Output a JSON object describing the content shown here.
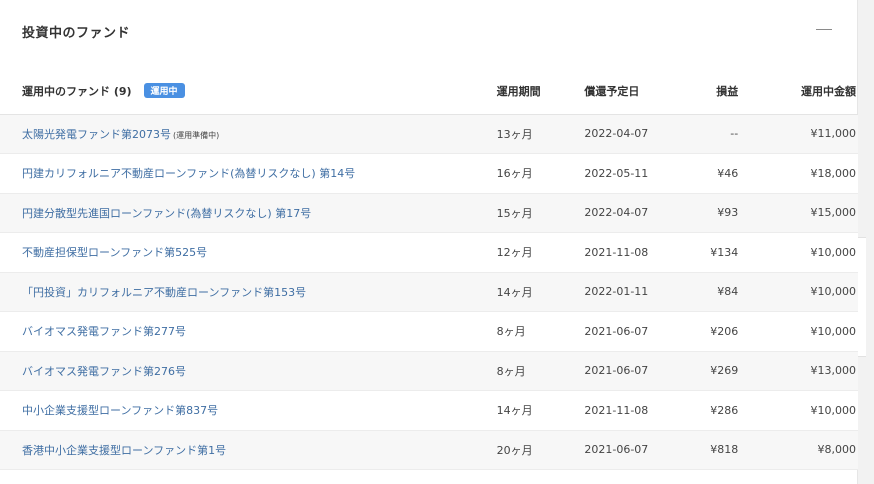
{
  "section": {
    "title": "投資中のファンド",
    "collapse_icon": "minus-icon"
  },
  "table": {
    "headers": {
      "name": "運用中のファンド (9)",
      "badge": "運用中",
      "period": "運用期間",
      "redemption_date": "償還予定日",
      "profit": "損益",
      "amount": "運用中金額"
    },
    "rows": [
      {
        "name": "太陽光発電ファンド第2073号",
        "note": "(運用準備中)",
        "period": "13ヶ月",
        "date": "2022-04-07",
        "profit": "--",
        "amount": "¥11,000"
      },
      {
        "name": "円建カリフォルニア不動産ローンファンド(為替リスクなし) 第14号",
        "note": "",
        "period": "16ヶ月",
        "date": "2022-05-11",
        "profit": "¥46",
        "amount": "¥18,000"
      },
      {
        "name": "円建分散型先進国ローンファンド(為替リスクなし) 第17号",
        "note": "",
        "period": "15ヶ月",
        "date": "2022-04-07",
        "profit": "¥93",
        "amount": "¥15,000"
      },
      {
        "name": "不動産担保型ローンファンド第525号",
        "note": "",
        "period": "12ヶ月",
        "date": "2021-11-08",
        "profit": "¥134",
        "amount": "¥10,000"
      },
      {
        "name": "「円投資」カリフォルニア不動産ローンファンド第153号",
        "note": "",
        "period": "14ヶ月",
        "date": "2022-01-11",
        "profit": "¥84",
        "amount": "¥10,000"
      },
      {
        "name": "バイオマス発電ファンド第277号",
        "note": "",
        "period": "8ヶ月",
        "date": "2021-06-07",
        "profit": "¥206",
        "amount": "¥10,000"
      },
      {
        "name": "バイオマス発電ファンド第276号",
        "note": "",
        "period": "8ヶ月",
        "date": "2021-06-07",
        "profit": "¥269",
        "amount": "¥13,000"
      },
      {
        "name": "中小企業支援型ローンファンド第837号",
        "note": "",
        "period": "14ヶ月",
        "date": "2021-11-08",
        "profit": "¥286",
        "amount": "¥10,000"
      },
      {
        "name": "香港中小企業支援型ローンファンド第1号",
        "note": "",
        "period": "20ヶ月",
        "date": "2021-06-07",
        "profit": "¥818",
        "amount": "¥8,000"
      }
    ]
  }
}
